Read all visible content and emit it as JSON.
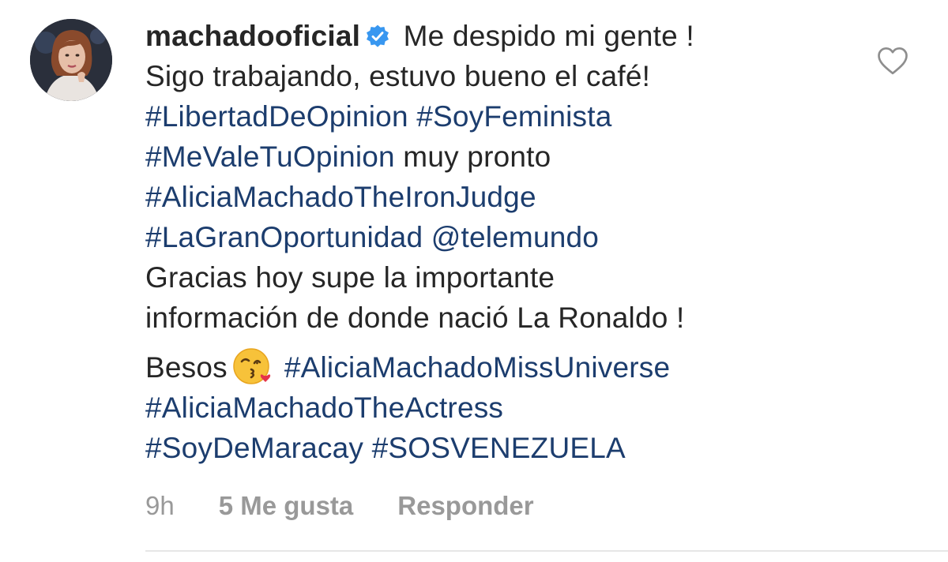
{
  "comment": {
    "username": "machadooficial",
    "verified": true,
    "lines": [
      [
        {
          "t": "text",
          "v": "Me despido mi gente !"
        }
      ],
      [
        {
          "t": "text",
          "v": "Sigo trabajando, estuvo bueno el café!"
        }
      ],
      [
        {
          "t": "tag",
          "v": "#LibertadDeOpinion"
        },
        {
          "t": "text",
          "v": " "
        },
        {
          "t": "tag",
          "v": "#SoyFeminista"
        }
      ],
      [
        {
          "t": "tag",
          "v": "#MeValeTuOpinion"
        },
        {
          "t": "text",
          "v": " muy pronto"
        }
      ],
      [
        {
          "t": "tag",
          "v": "#AliciaMachadoTheIronJudge"
        }
      ],
      [
        {
          "t": "tag",
          "v": "#LaGranOportunidad"
        },
        {
          "t": "text",
          "v": " "
        },
        {
          "t": "mention",
          "v": "@telemundo"
        }
      ],
      [
        {
          "t": "text",
          "v": "Gracias hoy supe la importante"
        }
      ],
      [
        {
          "t": "text",
          "v": "información de donde nació La Ronaldo !"
        }
      ],
      [
        {
          "t": "text",
          "v": "Besos"
        },
        {
          "t": "emoji",
          "v": "kiss-face"
        },
        {
          "t": "tag",
          "v": "#AliciaMachadoMissUniverse"
        }
      ],
      [
        {
          "t": "tag",
          "v": "#AliciaMachadoTheActress"
        }
      ],
      [
        {
          "t": "tag",
          "v": "#SoyDeMaracay"
        },
        {
          "t": "text",
          "v": " "
        },
        {
          "t": "tag",
          "v": "#SOSVENEZUELA"
        }
      ]
    ]
  },
  "meta": {
    "time": "9h",
    "likes": "5 Me gusta",
    "reply": "Responder"
  },
  "icons": {
    "verified": "verified-badge-icon",
    "like": "heart-icon",
    "emoji": "kissing-face-emoji"
  },
  "colors": {
    "hashtag": "#1c3d6e",
    "text": "#262626",
    "meta": "#999999",
    "verified": "#3897f0"
  }
}
